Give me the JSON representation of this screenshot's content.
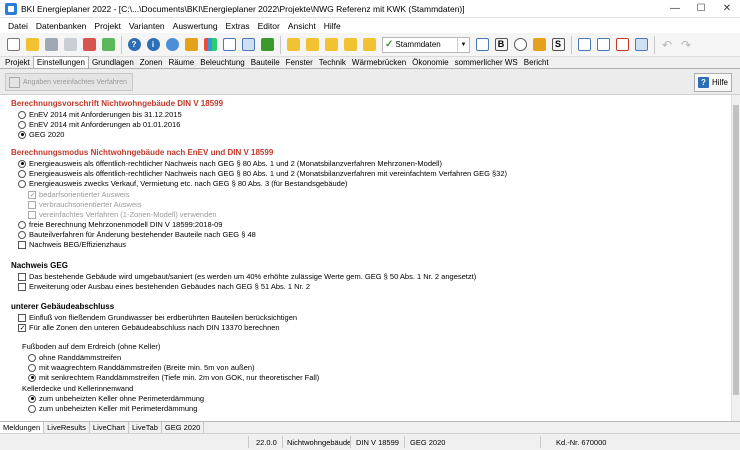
{
  "window": {
    "title": "BKI Energieplaner 2022 - [C:\\...\\Documents\\BKI\\Energieplaner 2022\\Projekte\\NWG Referenz mit KWK (Stammdaten)]",
    "minimize": "—",
    "maximize": "☐",
    "close": "✕"
  },
  "menu": [
    "Datei",
    "Datenbanken",
    "Projekt",
    "Varianten",
    "Auswertung",
    "Extras",
    "Editor",
    "Ansicht",
    "Hilfe"
  ],
  "toolbar": {
    "dropdown_value": "Stammdaten",
    "bold_label": "B",
    "s_label": "S",
    "help_glyph": "?",
    "info_glyph": "i"
  },
  "tabs": [
    "Projekt",
    "Einstellungen",
    "Grundlagen",
    "Zonen",
    "Räume",
    "Beleuchtung",
    "Bauteile",
    "Fenster",
    "Technik",
    "Wärmebrücken",
    "Ökonomie",
    "sommerlicher WS",
    "Bericht"
  ],
  "subbar": {
    "simplified_button": "Angaben vereinfachtes Verfahren",
    "help_button": "Hilfe",
    "help_glyph": "?"
  },
  "sections": {
    "vorschrift": {
      "title": "Berechnungsvorschrift Nichtwohngebäude DIN V 18599",
      "options": [
        "EnEV 2014 mit Anforderungen bis 31.12.2015",
        "EnEV 2014 mit Anforderungen ab 01.01.2016",
        "GEG 2020"
      ]
    },
    "modus": {
      "title": "Berechnungsmodus Nichtwohngebäude nach EnEV und DIN V 18599",
      "options": [
        "Energieausweis als öffentlich-rechtlicher Nachweis nach GEG § 80 Abs. 1 und 2 (Monatsbilanzverfahren Mehrzonen-Modell)",
        "Energieausweis als öffentlich-rechtlicher Nachweis nach GEG § 80 Abs. 1 und 2 (Monatsbilanzverfahren mit vereinfachtem Verfahren GEG §32)",
        "Energieausweis zwecks Verkauf, Vermietung etc. nach GEG § 80 Abs. 3 (für Bestandsgebäude)"
      ],
      "sub_options": [
        "bedarfsorientierter Ausweis",
        "verbrauchsorientierter Ausweis",
        "vereinfachtes Verfahren (1-Zonen-Modell) verwenden"
      ],
      "more_options": [
        "freie Berechnung Mehrzonenmodell DIN V 18599:2018-09",
        "Bauteilverfahren für Änderung bestehender Bauteile nach GEG § 48"
      ],
      "beg_checkbox": "Nachweis BEG/Effizienzhaus"
    },
    "nachweis": {
      "title": "Nachweis GEG",
      "options": [
        "Das bestehende Gebäude wird umgebaut/saniert (es werden um 40% erhöhte zulässige Werte gem. GEG § 50 Abs. 1 Nr. 2 angesetzt)",
        "Erweiterung oder Ausbau eines bestehenden Gebäudes nach GEG § 51 Abs. 1 Nr. 2"
      ]
    },
    "abschluss": {
      "title": "unterer Gebäudeabschluss",
      "options": [
        "Einfluß von fließendem Grundwasser bei erdberührten Bauteilen berücksichtigen",
        "Für alle Zonen den unteren Gebäudeabschluss nach DIN 13370 berechnen"
      ],
      "fussboden_label": "Fußboden auf dem Erdreich (ohne Keller)",
      "fussboden_options": [
        "ohne Randdämmstreifen",
        "mit waagrechtem Randdämmstreifen (Breite min. 5m von außen)",
        "mit senkrechtem Randdämmstreifen (Tiefe min. 2m von GOK, nur theoretischer Fall)"
      ],
      "keller_label": "Kellerdecke und Kellerinnenwand",
      "keller_options": [
        "zum unbeheizten Keller ohne Perimeterdämmung",
        "zum unbeheizten Keller mit Perimeterdämmung"
      ]
    }
  },
  "bottom_tabs": [
    "Meldungen",
    "LiveResults",
    "LiveChart",
    "LiveTab",
    "GEG 2020"
  ],
  "status": {
    "version": "22.0.0",
    "building_type": "Nichtwohngebäude",
    "norm": "DIN V 18599",
    "law": "GEG 2020",
    "customer_no": "Kd.-Nr. 670000"
  }
}
